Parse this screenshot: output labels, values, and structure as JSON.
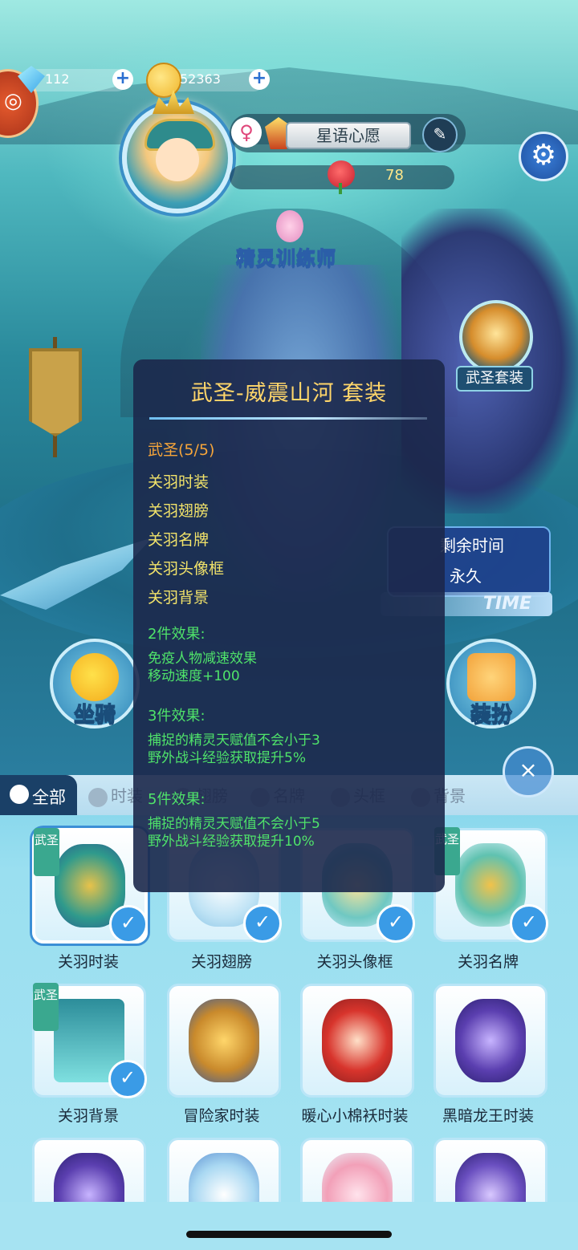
{
  "currency": {
    "gems": "112",
    "coins": "52363",
    "plus": "+"
  },
  "profile": {
    "gender": "♀",
    "name": "星语心愿",
    "edit": "✎",
    "charm": "78"
  },
  "settings_glyph": "⚙",
  "trainer_title": "精灵训练师",
  "suit_badge": "武圣套装",
  "time_panel": {
    "label": "剩余时间",
    "value": "永久",
    "strip": "TIME"
  },
  "buttons": {
    "mount": "坐骑",
    "outfit": "装扮"
  },
  "close": "×",
  "tabs": {
    "all": "全部",
    "items": [
      "时装",
      "翅膀",
      "名牌",
      "头框",
      "背景"
    ]
  },
  "popup": {
    "title": "武圣-威震山河 套装",
    "set_progress": "武圣(5/5)",
    "parts": [
      "关羽时装",
      "关羽翅膀",
      "关羽名牌",
      "关羽头像框",
      "关羽背景"
    ],
    "effects": [
      {
        "heading": "2件效果:",
        "lines": [
          "免疫人物减速效果",
          "移动速度+100"
        ]
      },
      {
        "heading": "3件效果:",
        "lines": [
          "捕捉的精灵天赋值不会小于3",
          "野外战斗经验获取提升5%"
        ]
      },
      {
        "heading": "5件效果:",
        "lines": [
          "捕捉的精灵天赋值不会小于5",
          "野外战斗经验获取提升10%"
        ]
      }
    ]
  },
  "cards": [
    {
      "name": "关羽时装",
      "tag": "武圣",
      "owned": true
    },
    {
      "name": "关羽翅膀",
      "tag": "",
      "owned": true
    },
    {
      "name": "关羽头像框",
      "tag": "",
      "owned": true
    },
    {
      "name": "关羽名牌",
      "tag": "武圣",
      "owned": true
    },
    {
      "name": "关羽背景",
      "tag": "武圣",
      "owned": true
    },
    {
      "name": "冒险家时装",
      "tag": "",
      "owned": false
    },
    {
      "name": "暖心小棉袄时装",
      "tag": "",
      "owned": false
    },
    {
      "name": "黑暗龙王时装",
      "tag": "",
      "owned": false
    }
  ],
  "check_glyph": "✓",
  "colors": {
    "popup_title": "#ffd66a",
    "set_name": "#f6a53a",
    "part": "#f2e36a",
    "effect": "#4fe36a",
    "tab_active": "#1a4067"
  }
}
